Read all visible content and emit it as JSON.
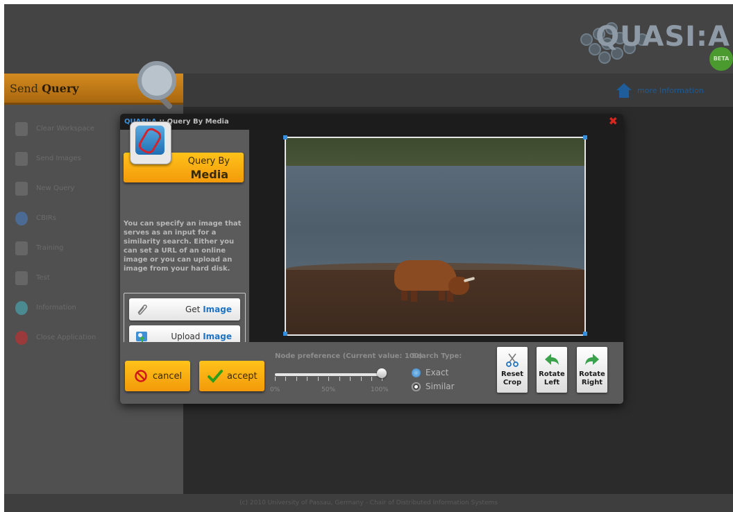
{
  "app": {
    "logo_text": "QUASI:A",
    "logo_badge": "BETA"
  },
  "send_query": {
    "label_normal": "Send ",
    "label_bold": "Query"
  },
  "sidebar": {
    "items": [
      {
        "label": "Clear Workspace"
      },
      {
        "label": "Send Images"
      },
      {
        "label": "New Query"
      },
      {
        "label": "CBIRs"
      },
      {
        "label": "Training"
      },
      {
        "label": "Test"
      },
      {
        "label": "Information"
      },
      {
        "label": "Close Application"
      }
    ]
  },
  "header": {
    "more_info": "more Information"
  },
  "footer": {
    "text": "(c) 2010 University of Passau, Germany - Chair of Distributed Information Systems"
  },
  "dialog": {
    "title_brand": "QUASI:A",
    "title_rest": " :: Query By Media",
    "close_symbol": "✖",
    "header_button": {
      "line1": "Query By",
      "line2": "Media"
    },
    "description": "You can specify an image that serves as an input for a similarity search. Either you can set a URL of an online image or you can upload an image from your hard disk.",
    "get_image": {
      "prefix": "Get ",
      "highlight": "Image"
    },
    "upload_image": {
      "prefix": "Upload ",
      "highlight": "Image"
    },
    "cancel_label": "cancel",
    "accept_label": "accept",
    "slider": {
      "title": "Node preference (Current value: 100)",
      "value_percent": 100,
      "scale": [
        "0%",
        "50%",
        "100%"
      ]
    },
    "search_type": {
      "title": "Search Type:",
      "options": [
        "Exact",
        "Similar"
      ],
      "selected": "Similar"
    },
    "tools": [
      {
        "line1": "Reset",
        "line2": "Crop",
        "icon": "scissors-icon"
      },
      {
        "line1": "Rotate",
        "line2": "Left",
        "icon": "rotate-left-arrow-icon"
      },
      {
        "line1": "Rotate",
        "line2": "Right",
        "icon": "rotate-right-arrow-icon"
      }
    ],
    "colors": {
      "accent_orange": "#f7a511",
      "link_blue": "#1e74c4",
      "close_red": "#d8261f"
    }
  }
}
